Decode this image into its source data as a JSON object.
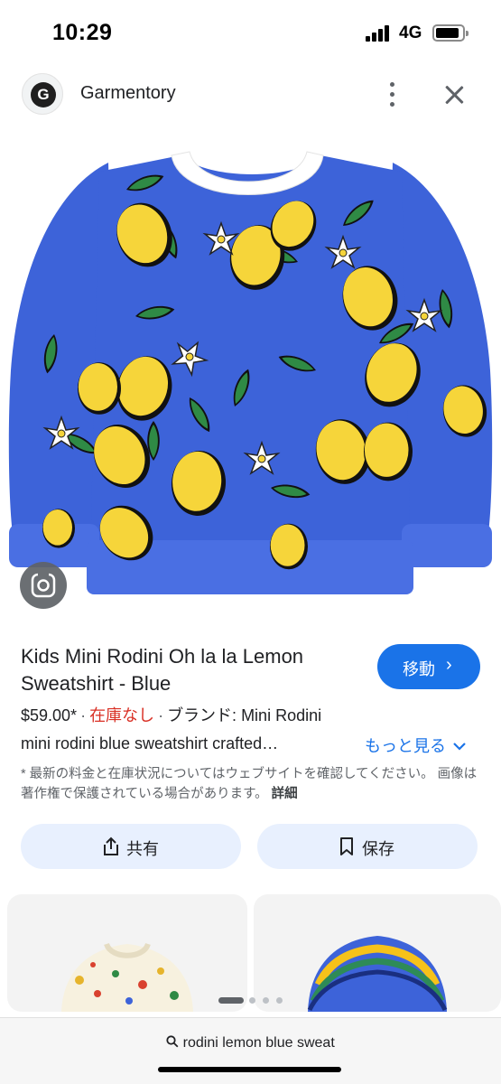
{
  "status_bar": {
    "time": "10:29",
    "network": "4G"
  },
  "header": {
    "site_name": "Garmentory",
    "logo_letter": "G"
  },
  "product": {
    "title": "Kids Mini Rodini Oh la la Lemon Sweatshirt - Blue",
    "go_label": "移動",
    "price": "$59.00*",
    "stock": "在庫なし",
    "brand": "ブランド: Mini Rodini",
    "description": "mini rodini blue sweatshirt crafted…",
    "more_label": "もっと見る",
    "disclaimer": "* 最新の料金と在庫状況についてはウェブサイトを確認してください。 画像は著作権で保護されている場合があります。",
    "detail_label": "詳細"
  },
  "actions": {
    "share_label": "共有",
    "save_label": "保存"
  },
  "pager": {
    "current": 1,
    "total": 4
  },
  "search": {
    "query": "rodini lemon blue sweat"
  },
  "colors": {
    "accent": "#1a73e8",
    "out_of_stock": "#d93025",
    "sweater_blue": "#3d63d9",
    "lemon": "#f6d53a",
    "leaf": "#2f8a45"
  },
  "icons": [
    "site-logo",
    "more-vert-icon",
    "close-icon",
    "lens-icon",
    "chevron-right-icon",
    "chevron-down-icon",
    "share-icon",
    "bookmark-icon",
    "search-icon"
  ]
}
